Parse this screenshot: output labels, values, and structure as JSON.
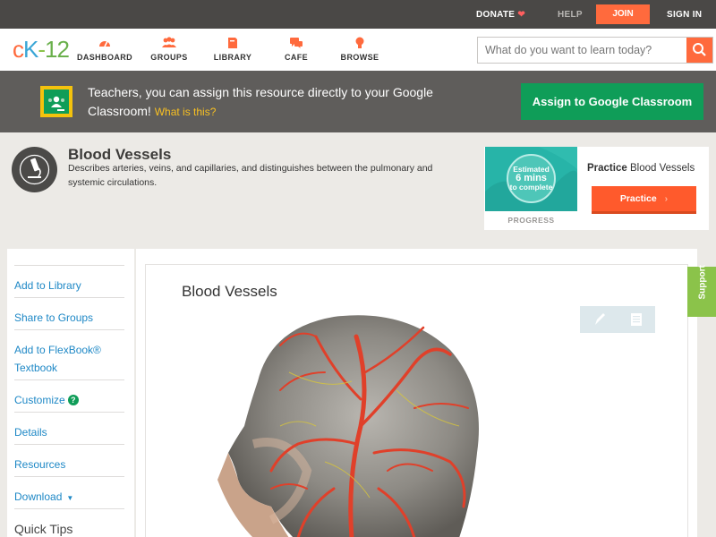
{
  "topbar": {
    "donate": "DONATE",
    "help": "HELP",
    "join": "JOIN",
    "signin": "SIGN IN"
  },
  "nav": {
    "logo": {
      "c": "c",
      "k": "K",
      "dash": "-",
      "n": "12"
    },
    "items": [
      {
        "label": "DASHBOARD",
        "icon": "dashboard-icon"
      },
      {
        "label": "GROUPS",
        "icon": "groups-icon"
      },
      {
        "label": "LIBRARY",
        "icon": "library-icon"
      },
      {
        "label": "CAFE",
        "icon": "cafe-icon"
      },
      {
        "label": "BROWSE",
        "icon": "browse-icon"
      }
    ],
    "search_placeholder": "What do you want to learn today?"
  },
  "classroom": {
    "text": "Teachers, you can assign this resource directly to your Google Classroom!",
    "what": "What is this?",
    "button": "Assign to Google Classroom"
  },
  "header": {
    "title": "Blood Vessels",
    "description": "Describes arteries, veins, and capillaries, and distinguishes between the pulmonary and systemic circulations."
  },
  "practice": {
    "estimated": "Estimated",
    "mins": "6 mins",
    "to_complete": "to complete",
    "progress": "PROGRESS",
    "title_bold": "Practice",
    "title_rest": "Blood Vessels",
    "button": "Practice"
  },
  "sidebar": {
    "items": [
      {
        "label": "Add to Library"
      },
      {
        "label": "Share to Groups"
      },
      {
        "label": "Add to FlexBook® Textbook"
      },
      {
        "label": "Customize"
      },
      {
        "label": "Details"
      },
      {
        "label": "Resources"
      },
      {
        "label": "Download"
      },
      {
        "label": "Quick Tips"
      }
    ]
  },
  "content": {
    "title": "Blood Vessels"
  },
  "support": "Support",
  "colors": {
    "accent_orange": "#ff6a3d",
    "classroom_green": "#0f9d58",
    "link_blue": "#1e88c6",
    "support_green": "#8bc34a"
  }
}
